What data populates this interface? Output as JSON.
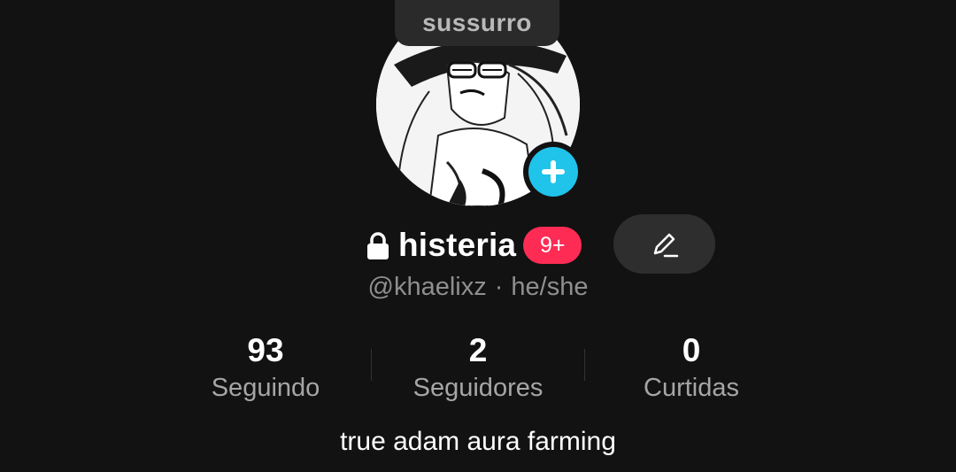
{
  "note": {
    "text": "sussurro"
  },
  "profile": {
    "display_name": "histeria",
    "notification_badge": "9+",
    "username": "@khaelixz",
    "separator": "·",
    "pronouns": "he/she",
    "bio": "true adam aura farming"
  },
  "stats": [
    {
      "value": "93",
      "label": "Seguindo"
    },
    {
      "value": "2",
      "label": "Seguidores"
    },
    {
      "value": "0",
      "label": "Curtidas"
    }
  ],
  "icons": {
    "lock": "lock-icon",
    "add": "plus-icon",
    "edit": "pencil-icon"
  },
  "colors": {
    "background": "#121212",
    "accent_add": "#20c3ea",
    "badge": "#fe2c55",
    "edit_button": "#2e2e2e"
  }
}
